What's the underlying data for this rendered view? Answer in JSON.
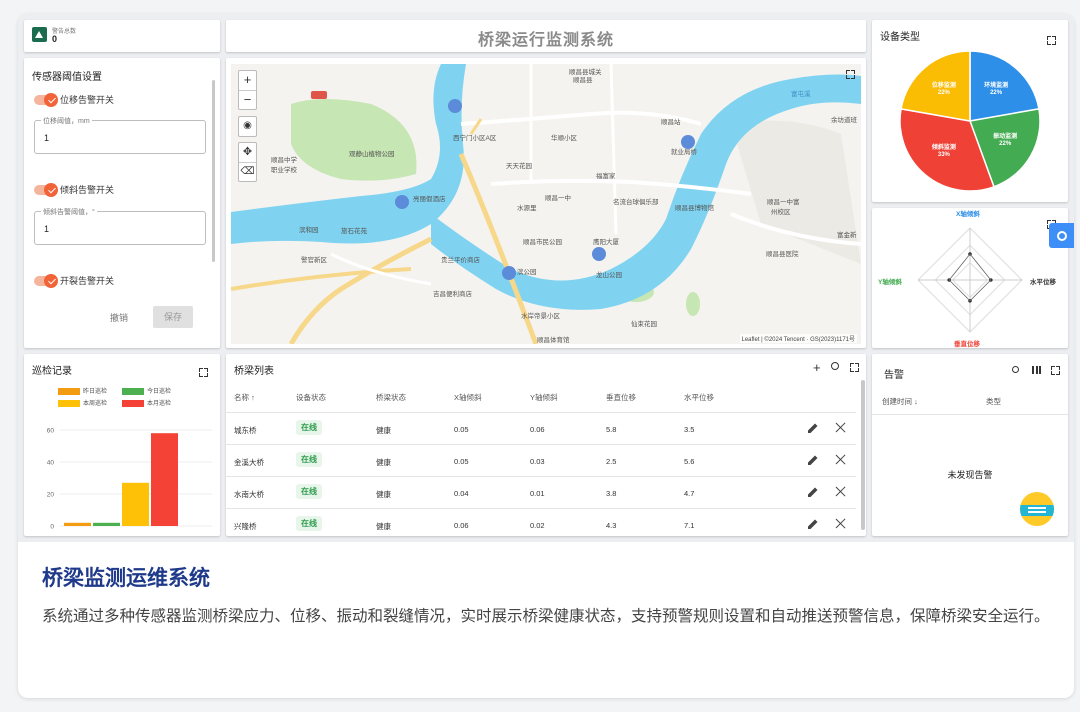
{
  "alarm": {
    "label": "警告总数",
    "count": "0"
  },
  "header": {
    "title": "桥梁运行监测系统"
  },
  "threshold": {
    "title": "传感器阈值设置",
    "displacement_toggle": "位移告警开关",
    "displacement_field_label": "位移阈值，mm",
    "displacement_value": "1",
    "tilt_toggle": "倾斜告警开关",
    "tilt_field_label": "倾斜告警阈值，°",
    "tilt_value": "1",
    "crack_toggle": "开裂告警开关",
    "cancel": "撤销",
    "save": "保存"
  },
  "map": {
    "labels": [
      "顺昌县城关",
      "顺昌县",
      "西宁门小区A区",
      "华顺小区",
      "顺昌站",
      "余坊道班",
      "顺昌中学",
      "职业学校",
      "观静山植物公园",
      "天天花园",
      "福富家",
      "水源里",
      "顺昌一中",
      "名流台球俱乐部",
      "顺昌县博物馆",
      "顺昌一中富",
      "州校区",
      "亮丽假酒店",
      "滨和园",
      "旅石花苑",
      "顺昌市民公园",
      "鹰阳大厦",
      "富金新",
      "警官新区",
      "贵兰平价商店",
      "滨公园",
      "龙山公园",
      "顺昌县医院",
      "吉昌便利商店",
      "水岸帝景小区",
      "顺昌体育馆",
      "仙束花园",
      "就业局桥",
      "富屯溪"
    ],
    "attribution": "Leaflet | ©2024 Tencent · GS(2023)1171号",
    "zoom_in": "+",
    "zoom_out": "−"
  },
  "device_type": {
    "title": "设备类型",
    "chart_data": {
      "type": "pie",
      "categories": [
        "环境监测",
        "振动监测",
        "倾斜监测",
        "位移监测"
      ],
      "values": [
        22,
        22,
        33,
        22
      ],
      "colors": [
        "#2d8fe8",
        "#43ab51",
        "#ef4136",
        "#fbbc04"
      ]
    }
  },
  "radar": {
    "chart_data": {
      "type": "radar",
      "categories": [
        "X轴倾斜",
        "水平位移",
        "垂直位移",
        "Y轴倾斜"
      ],
      "values": [
        0.05,
        0.04,
        0.04,
        0.04
      ],
      "max": 0.1
    }
  },
  "inspection": {
    "title": "巡检记录",
    "chart_data": {
      "type": "bar",
      "categories": [
        "昨日巡检",
        "今日巡检",
        "本周巡检",
        "本月巡检"
      ],
      "values": [
        2,
        2,
        27,
        58
      ],
      "colors": [
        "#f39c12",
        "#4caf50",
        "#ffc107",
        "#f44336"
      ],
      "ylim": [
        0,
        60
      ],
      "yticks": [
        "0",
        "20",
        "40",
        "60"
      ]
    }
  },
  "bridges": {
    "title": "桥梁列表",
    "columns": [
      "名称 ↑",
      "设备状态",
      "桥梁状态",
      "X轴倾斜",
      "Y轴倾斜",
      "垂直位移",
      "水平位移"
    ],
    "rows": [
      {
        "name": "城东桥",
        "status": "在线",
        "health": "健康",
        "x": "0.05",
        "y": "0.06",
        "v": "5.8",
        "h": "3.5"
      },
      {
        "name": "金溪大桥",
        "status": "在线",
        "health": "健康",
        "x": "0.05",
        "y": "0.03",
        "v": "2.5",
        "h": "5.6"
      },
      {
        "name": "水南大桥",
        "status": "在线",
        "health": "健康",
        "x": "0.04",
        "y": "0.01",
        "v": "3.8",
        "h": "4.7"
      },
      {
        "name": "兴隆桥",
        "status": "在线",
        "health": "健康",
        "x": "0.06",
        "y": "0.02",
        "v": "4.3",
        "h": "7.1"
      }
    ]
  },
  "alerts": {
    "title": "告警",
    "col_time": "创建时间 ↓",
    "col_type": "类型",
    "empty": "未发现告警"
  },
  "description": {
    "title": "桥梁监测运维系统",
    "body": "系统通过多种传感器监测桥梁应力、位移、振动和裂缝情况，实时展示桥梁健康状态，支持预警规则设置和自动推送预警信息，保障桥梁安全运行。"
  },
  "colors": {
    "accent": "#1f3a8a",
    "toggle": "#f1643a",
    "online": "#2e9d4c",
    "river": "#7fd3f0"
  }
}
